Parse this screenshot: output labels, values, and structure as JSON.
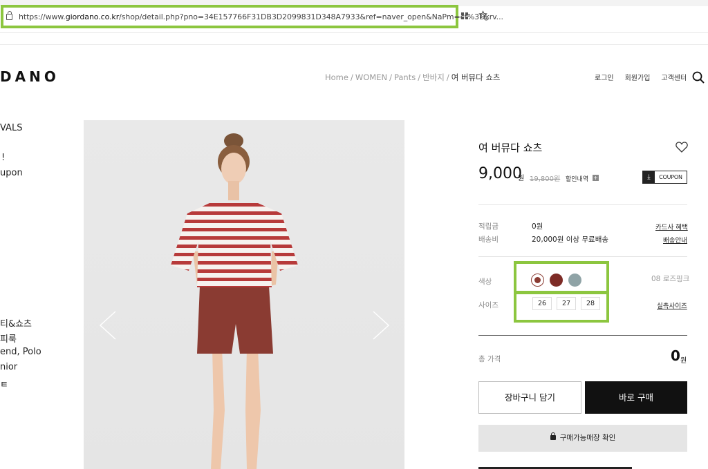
{
  "browser": {
    "url_prefix": "https://www.",
    "url_domain": "giordano.co.kr",
    "url_rest": "/shop/detail.php?pno=34E157766F31DB3D2099831D348A7933&ref=naver_open&NaPm=ct%3Dkrv..."
  },
  "site": {
    "logo": "DANO",
    "breadcrumb": {
      "home": "Home",
      "cat1": "WOMEN",
      "cat2": "Pants",
      "cat3": "반바지",
      "current": "여 버뮤다 쇼츠",
      "sep": "/"
    },
    "header_links": {
      "login": "로그인",
      "signup": "회원가입",
      "support": "고객센터"
    }
  },
  "left_menu": {
    "items": [
      "VALS",
      "!",
      "upon",
      "티&쇼츠",
      "피룩",
      "end, Polo",
      "nior",
      "ㅌ"
    ]
  },
  "product": {
    "title": "여 버뮤다 쇼츠",
    "price": "9,000",
    "price_unit": "원",
    "original_price": "19,800원",
    "discount_label": "할인내역",
    "coupon_label": "COUPON",
    "points_label": "적립금",
    "points_value": "0원",
    "card_benefit": "카드사 혜택",
    "shipping_label": "배송비",
    "shipping_value": "20,000원 이상 무료배송",
    "shipping_info": "배송안내",
    "color_label": "색상",
    "selected_color": "08 로즈핑크",
    "colors": [
      "#8a3b32",
      "#7d2b26",
      "#8fa3a6"
    ],
    "size_label": "사이즈",
    "sizes": [
      "26",
      "27",
      "28"
    ],
    "size_guide": "실측사이즈",
    "total_label": "총 가격",
    "total_value": "0",
    "total_unit": "원",
    "cart_button": "장바구니 담기",
    "buy_button": "바로 구매",
    "store_button": "구매가능매장 확인"
  }
}
